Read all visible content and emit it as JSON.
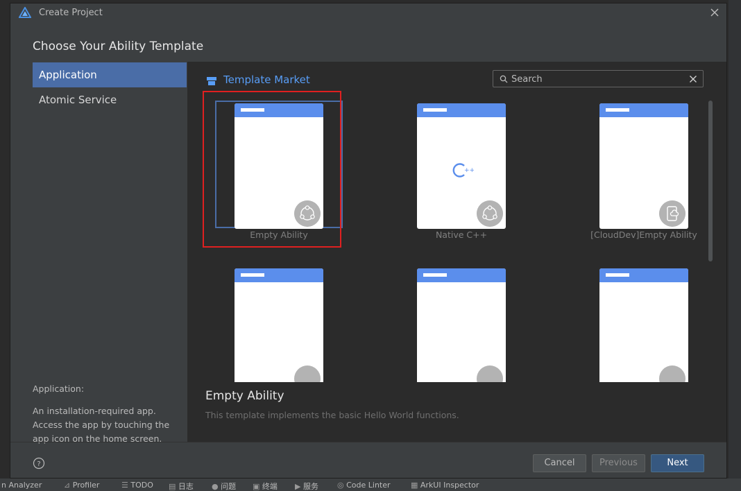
{
  "window": {
    "title": "Create Project"
  },
  "heading": "Choose Your Ability Template",
  "sidebar": {
    "items": [
      {
        "label": "Application",
        "selected": true
      },
      {
        "label": "Atomic Service",
        "selected": false
      }
    ],
    "description_title": "Application:",
    "description_text": "An installation-required app. Access the app by touching the app icon on the home screen."
  },
  "market": {
    "label": "Template Market"
  },
  "search": {
    "placeholder": "Search",
    "value": ""
  },
  "templates": [
    {
      "label": "Empty Ability",
      "selected": true,
      "icon": "ability-icon"
    },
    {
      "label": "Native C++",
      "selected": false,
      "icon": "cplusplus-icon"
    },
    {
      "label": "[CloudDev]Empty Ability",
      "selected": false,
      "icon": "cloud-phone-icon"
    },
    {
      "label": "",
      "selected": false,
      "icon": "template-icon"
    },
    {
      "label": "",
      "selected": false,
      "icon": "template-icon"
    },
    {
      "label": "",
      "selected": false,
      "icon": "template-icon"
    }
  ],
  "detail": {
    "title": "Empty Ability",
    "description": "This template implements the basic Hello World functions."
  },
  "buttons": {
    "cancel": "Cancel",
    "previous": "Previous",
    "next": "Next"
  },
  "ide_bottom": [
    "n Analyzer",
    "Profiler",
    "TODO",
    "日志",
    "问题",
    "终端",
    "服务",
    "Code Linter",
    "ArkUI Inspector"
  ],
  "colors": {
    "accent": "#589df6",
    "selected_nav": "#4a6da7",
    "phone_bar": "#5b8eec",
    "highlight": "#e02020",
    "primary_button": "#365880"
  }
}
